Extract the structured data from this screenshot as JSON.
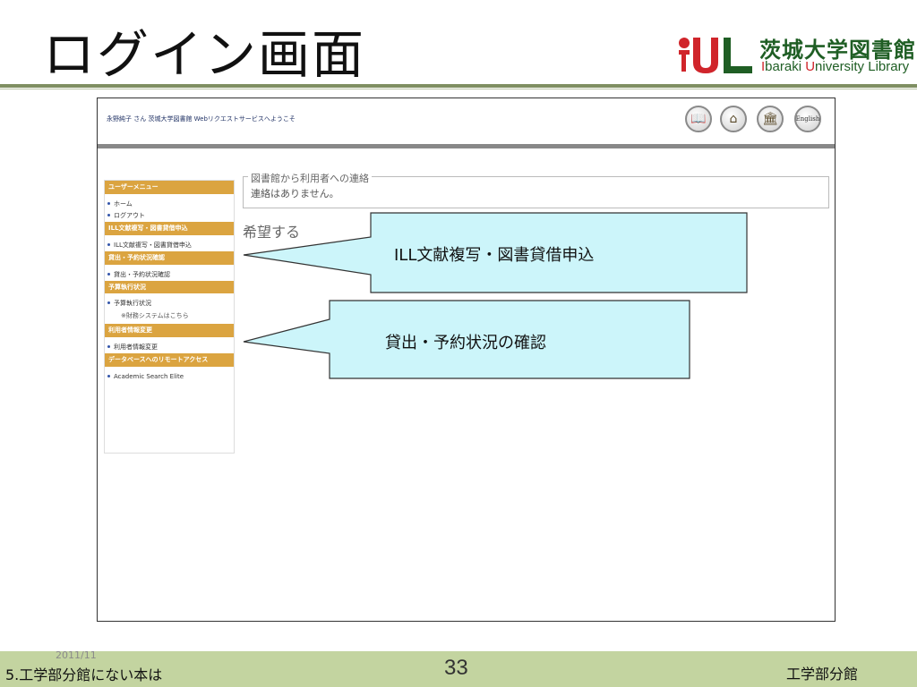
{
  "slide": {
    "title": "ログイン画面",
    "logo": {
      "name_jp": "茨城大学図書館",
      "name_en_part1": "I",
      "name_en_part2": "baraki ",
      "name_en_part3": "U",
      "name_en_part4": "niversity Library",
      "brand_red": "#d0252b",
      "brand_green": "#1f5e24"
    }
  },
  "screenshot": {
    "welcome": "永野純子 さん 茨城大学図書館 Webリクエストサービスへようこそ",
    "nav_icons": [
      {
        "icon": "book-icon"
      },
      {
        "icon": "home-icon"
      },
      {
        "icon": "library-icon"
      },
      {
        "icon": "english-icon",
        "label": "English"
      }
    ],
    "sidebar": {
      "user_menu": {
        "heading": "ユーザーメニュー",
        "items": [
          "ホーム",
          "ログアウト"
        ]
      },
      "ill": {
        "heading": "ILL文献複写・図書貸借申込",
        "items": [
          "ILL文献複写・図書貸借申込"
        ]
      },
      "loan": {
        "heading": "貸出・予約状況確認",
        "items": [
          "貸出・予約状況確認"
        ]
      },
      "budget": {
        "heading": "予算執行状況",
        "items": [
          "予算執行状況"
        ],
        "note": "※財務システムはこちら"
      },
      "user_info": {
        "heading": "利用者情報変更",
        "items": [
          "利用者情報変更"
        ]
      },
      "remote": {
        "heading": "データベースへのリモートアクセス",
        "items": [
          "Academic Search Elite"
        ]
      }
    },
    "notice": {
      "legend": "図書館から利用者への連絡",
      "text": "連絡はありません。"
    },
    "hope_heading": "希望する"
  },
  "callouts": [
    {
      "text": "ILL文献複写・図書貸借申込"
    },
    {
      "text": "貸出・予約状況の確認"
    }
  ],
  "footer": {
    "date": "2011/11",
    "left": "5.工学部分館にない本は",
    "page": "33",
    "right": "工学部分館"
  },
  "colors": {
    "sidebar_heading": "#dba440",
    "callout_fill": "#ccf5fa",
    "footer_bg": "#c3d4a0",
    "title_rule": "#7f8f62"
  }
}
